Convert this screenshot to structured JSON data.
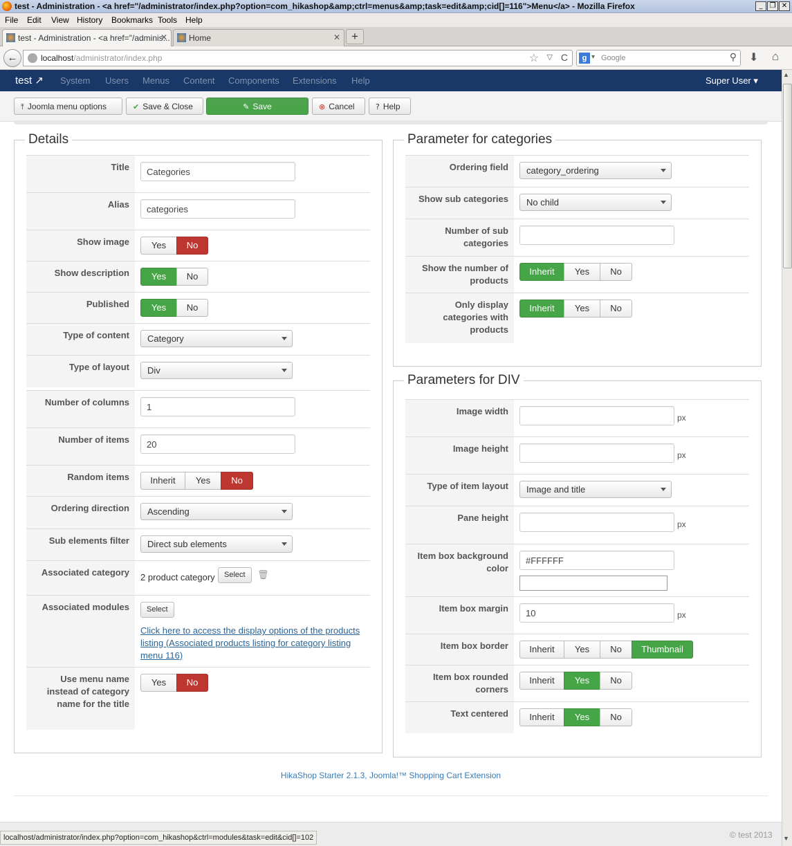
{
  "window": {
    "title": "test - Administration - <a href=\"/administrator/index.php?option=com_hikashop&amp;ctrl=menus&amp;task=edit&amp;cid[]=116\">Menu</a> - Mozilla Firefox",
    "min": "_",
    "max": "❐",
    "close": "✕"
  },
  "menubar": [
    "File",
    "Edit",
    "View",
    "History",
    "Bookmarks",
    "Tools",
    "Help"
  ],
  "tabs": [
    {
      "label": "test - Administration - <a href=\"/adminis...",
      "close": "✕"
    },
    {
      "label": "Home",
      "close": "✕"
    }
  ],
  "newtab": "+",
  "nav": {
    "back": "←",
    "url_host": "localhost",
    "url_path": "/administrator/index.php",
    "star": "☆",
    "dropdown": "▽",
    "reload": "C",
    "search_engine": "g",
    "search_dropdown": "▾",
    "search_placeholder": "Google",
    "search_icon": "⚲",
    "download": "⬇",
    "home": "⌂"
  },
  "joomla": {
    "brand": "test ↗",
    "menu": [
      "System",
      "Users",
      "Menus",
      "Content",
      "Components",
      "Extensions",
      "Help"
    ],
    "user": "Super User ▾"
  },
  "toolbar": {
    "menu_options": "Joomla menu options",
    "save_close": "Save & Close",
    "save": "Save",
    "cancel": "Cancel",
    "help": "Help"
  },
  "details": {
    "legend": "Details",
    "title_label": "Title",
    "title_value": "Categories",
    "alias_label": "Alias",
    "alias_value": "categories",
    "show_image_label": "Show image",
    "show_desc_label": "Show description",
    "published_label": "Published",
    "yes": "Yes",
    "no": "No",
    "inherit": "Inherit",
    "type_content_label": "Type of content",
    "type_content_value": "Category",
    "type_layout_label": "Type of layout",
    "type_layout_value": "Div",
    "num_columns_label": "Number of columns",
    "num_columns_value": "1",
    "num_items_label": "Number of items",
    "num_items_value": "20",
    "random_label": "Random items",
    "ordering_dir_label": "Ordering direction",
    "ordering_dir_value": "Ascending",
    "sub_filter_label": "Sub elements filter",
    "sub_filter_value": "Direct sub elements",
    "assoc_cat_label": "Associated category",
    "assoc_cat_value": "2 product category",
    "select": "Select",
    "assoc_mod_label": "Associated modules",
    "assoc_link": "Click here to access the display options of the products listing (Associated products listing for category listing menu 116)",
    "use_menu_name_label": "Use menu name instead of category name for the title"
  },
  "params_cat": {
    "legend": "Parameter for categories",
    "ordering_field_label": "Ordering field",
    "ordering_field_value": "category_ordering",
    "show_sub_label": "Show sub categories",
    "show_sub_value": "No child",
    "num_sub_label": "Number of sub categories",
    "num_sub_value": "",
    "show_num_label": "Show the number of products",
    "only_display_label": "Only display categories with products"
  },
  "params_div": {
    "legend": "Parameters for DIV",
    "img_width_label": "Image width",
    "img_height_label": "Image height",
    "px": "px",
    "item_layout_label": "Type of item layout",
    "item_layout_value": "Image and title",
    "pane_height_label": "Pane height",
    "bg_color_label": "Item box background color",
    "bg_color_value": "#FFFFFF",
    "margin_label": "Item box margin",
    "margin_value": "10",
    "border_label": "Item box border",
    "thumbnail": "Thumbnail",
    "rounded_label": "Item box rounded corners",
    "centered_label": "Text centered"
  },
  "footer": "HikaShop Starter 2.1.3, Joomla!™ Shopping Cart Extension",
  "copyright": "© test 2013",
  "statusbar": "localhost/administrator/index.php?option=com_hikashop&ctrl=modules&task=edit&cid[]=102",
  "colors": {
    "navy": "#1a3867",
    "green": "#46a546",
    "red": "#bd362f"
  }
}
